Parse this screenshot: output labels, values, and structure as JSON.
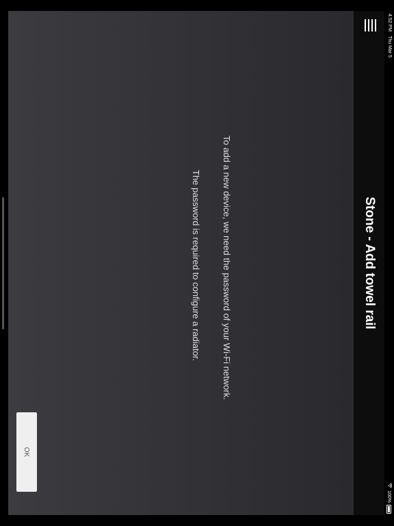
{
  "status_bar": {
    "time": "4:52 PM",
    "date": "Thu Mar 5",
    "battery": "100%",
    "wifi_icon": "wifi-icon",
    "battery_icon": "battery-icon"
  },
  "header": {
    "title": "Stone - Add towel rail",
    "menu_icon": "hamburger-menu-icon"
  },
  "main": {
    "message_line1": "To add a new device, we need the password of your Wi-Fi network.",
    "message_line2": "The password is required to configure a radiator.",
    "ok_label": "OK"
  },
  "colors": {
    "header_bg": "#0d0d0e",
    "content_bg_top": "#2a2a2e",
    "content_bg_bottom": "#3c3c40",
    "button_bg": "#efefef"
  }
}
